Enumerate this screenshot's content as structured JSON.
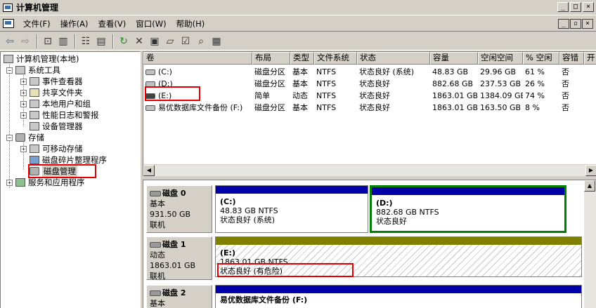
{
  "window": {
    "title": "计算机管理",
    "btn_min": "_",
    "btn_max": "□",
    "btn_close": "×"
  },
  "menu": [
    "文件(F)",
    "操作(A)",
    "查看(V)",
    "窗口(W)",
    "帮助(H)"
  ],
  "mdi": {
    "min": "_",
    "restore": "▫",
    "close": "×"
  },
  "toolbar_icons": [
    "back-icon",
    "forward-icon",
    "up-folder-icon",
    "show-hide-tree-icon",
    "properties-icon",
    "help-icon",
    "refresh-icon",
    "delete-icon",
    "export-icon",
    "open-icon",
    "check-icon",
    "search-icon",
    "settings-icon"
  ],
  "tree": {
    "root": "计算机管理(本地)",
    "system_tools": "系统工具",
    "event_viewer": "事件查看器",
    "shared_folders": "共享文件夹",
    "local_users": "本地用户和组",
    "perf_logs": "性能日志和警报",
    "device_manager": "设备管理器",
    "storage": "存储",
    "removable": "可移动存储",
    "defrag": "磁盘碎片整理程序",
    "disk_mgmt": "磁盘管理",
    "services_apps": "服务和应用程序"
  },
  "columns": [
    "卷",
    "布局",
    "类型",
    "文件系统",
    "状态",
    "容量",
    "空闲空间",
    "% 空闲",
    "容错",
    "开"
  ],
  "volumes": [
    {
      "name": "(C:)",
      "layout": "磁盘分区",
      "type": "基本",
      "fs": "NTFS",
      "status": "状态良好 (系统)",
      "capacity": "48.83 GB",
      "free": "29.96 GB",
      "pct": "61 %",
      "ft": "否"
    },
    {
      "name": "(D:)",
      "layout": "磁盘分区",
      "type": "基本",
      "fs": "NTFS",
      "status": "状态良好",
      "capacity": "882.68 GB",
      "free": "237.53 GB",
      "pct": "26 %",
      "ft": "否"
    },
    {
      "name": "(E:)",
      "layout": "简单",
      "type": "动态",
      "fs": "NTFS",
      "status": "状态良好",
      "capacity": "1863.01 GB",
      "free": "1384.09 GB",
      "pct": "74 %",
      "ft": "否"
    },
    {
      "name": "易优数据库文件备份 (F:)",
      "layout": "磁盘分区",
      "type": "基本",
      "fs": "NTFS",
      "status": "状态良好",
      "capacity": "1863.01 GB",
      "free": "163.50 GB",
      "pct": "8 %",
      "ft": "否"
    }
  ],
  "disks": [
    {
      "name": "磁盘 0",
      "type": "基本",
      "size": "931.50 GB",
      "state": "联机",
      "parts": [
        {
          "label": "(C:)",
          "size": "48.83 GB NTFS",
          "status": "状态良好 (系统)"
        },
        {
          "label": "(D:)",
          "size": "882.68 GB NTFS",
          "status": "状态良好"
        }
      ]
    },
    {
      "name": "磁盘 1",
      "type": "动态",
      "size": "1863.01 GB",
      "state": "联机",
      "parts": [
        {
          "label": "(E:)",
          "size": "1863.01 GB NTFS",
          "status": "状态良好 (有危险)"
        }
      ]
    },
    {
      "name": "磁盘 2",
      "type": "基本",
      "size": "",
      "state": "",
      "parts": [
        {
          "label": "易优数据库文件备份 (F:)",
          "size": "",
          "status": ""
        }
      ]
    }
  ],
  "colors": {
    "primary_partition": "#0000a8",
    "dynamic_simple": "#808000",
    "selection": "#008000",
    "highlight": "#e00000"
  }
}
